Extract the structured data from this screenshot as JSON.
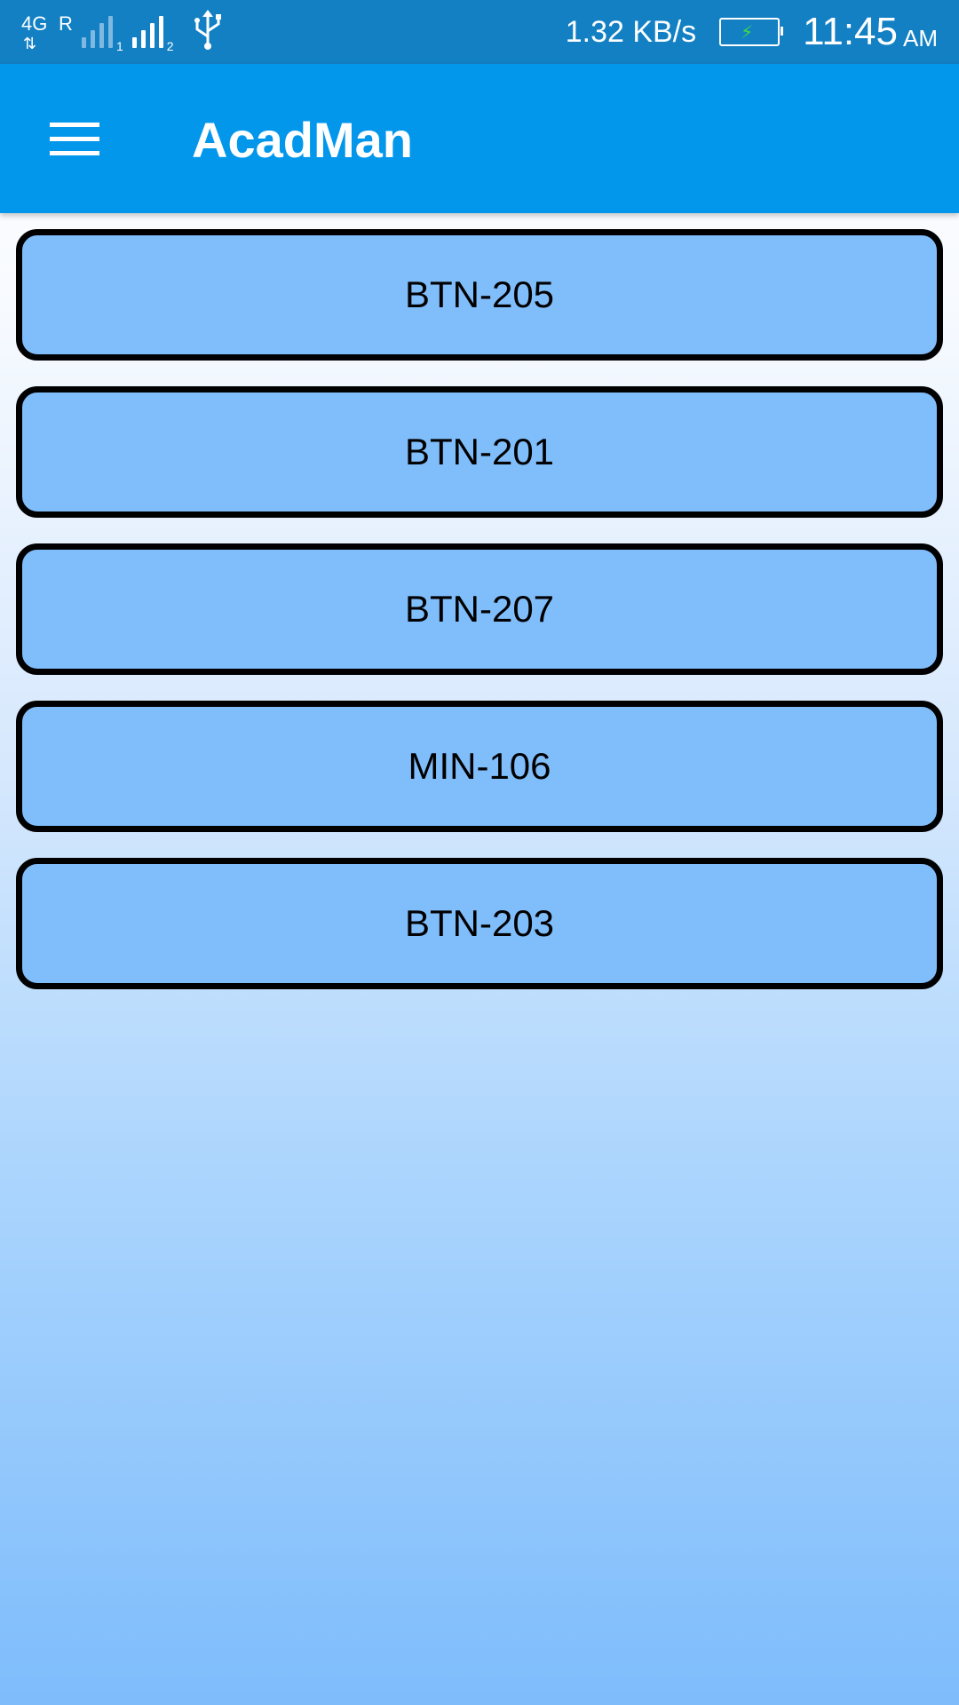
{
  "status_bar": {
    "network_type": "4G",
    "roaming": "R",
    "data_arrows": "⇅",
    "sim1_label": "1",
    "sim2_label": "2",
    "net_speed": "1.32 KB/s",
    "time": "11:45",
    "ampm": "AM",
    "icons": [
      "signal-icon",
      "usb-icon",
      "battery-charging-icon"
    ]
  },
  "app_bar": {
    "title": "AcadMan",
    "menu_icon": "hamburger-menu-icon",
    "color": "#0397ec"
  },
  "rooms": [
    {
      "label": "BTN-205"
    },
    {
      "label": "BTN-201"
    },
    {
      "label": "BTN-207"
    },
    {
      "label": "MIN-106"
    },
    {
      "label": "BTN-203"
    }
  ],
  "colors": {
    "status_bar": "#1380c4",
    "button_fill": "#80bdfb",
    "button_border": "#000000"
  }
}
